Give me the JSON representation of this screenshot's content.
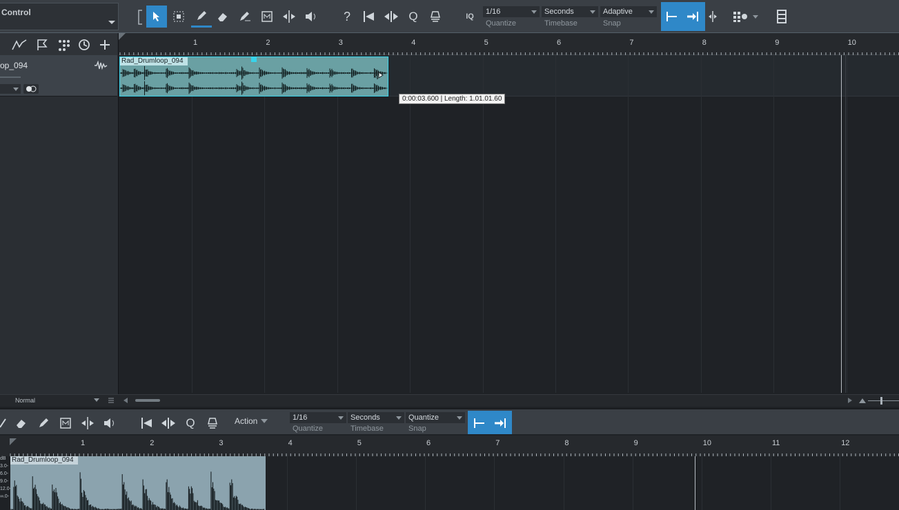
{
  "toolbar": {
    "control_label": "Control",
    "quantize": {
      "value": "1/16",
      "label": "Quantize"
    },
    "timebase": {
      "value": "Seconds",
      "label": "Timebase"
    },
    "snap": {
      "value": "Adaptive",
      "label": "Snap"
    },
    "iq_label": "IQ",
    "help_symbol": "?",
    "q_symbol": "Q"
  },
  "track": {
    "name": "op_094",
    "mode": "Normal"
  },
  "ruler": {
    "marks": [
      "1",
      "2",
      "3",
      "4",
      "5",
      "6",
      "7",
      "8",
      "9",
      "10"
    ]
  },
  "clip": {
    "name": "Rad_Drumloop_094"
  },
  "tooltip": {
    "text": "0:00:03.600 | Length: 1.01.01.60"
  },
  "editor": {
    "action_label": "Action",
    "quantize": {
      "value": "1/16",
      "label": "Quantize"
    },
    "timebase": {
      "value": "Seconds",
      "label": "Timebase"
    },
    "snap": {
      "value": "Quantize",
      "label": "Snap"
    },
    "q_symbol": "Q",
    "ruler_marks": [
      "1",
      "2",
      "3",
      "4",
      "5",
      "6",
      "7",
      "8",
      "9",
      "10",
      "11",
      "12"
    ],
    "clip_name": "Rad_Drumloop_094",
    "db_labels": [
      "dB",
      "3.0-",
      "6.0-",
      "9.0-",
      "12.0-",
      "∞.0-"
    ]
  },
  "colors": {
    "accent": "#2f88c8",
    "clip": "#6aa0a3",
    "clip_border": "#38d3ea"
  }
}
